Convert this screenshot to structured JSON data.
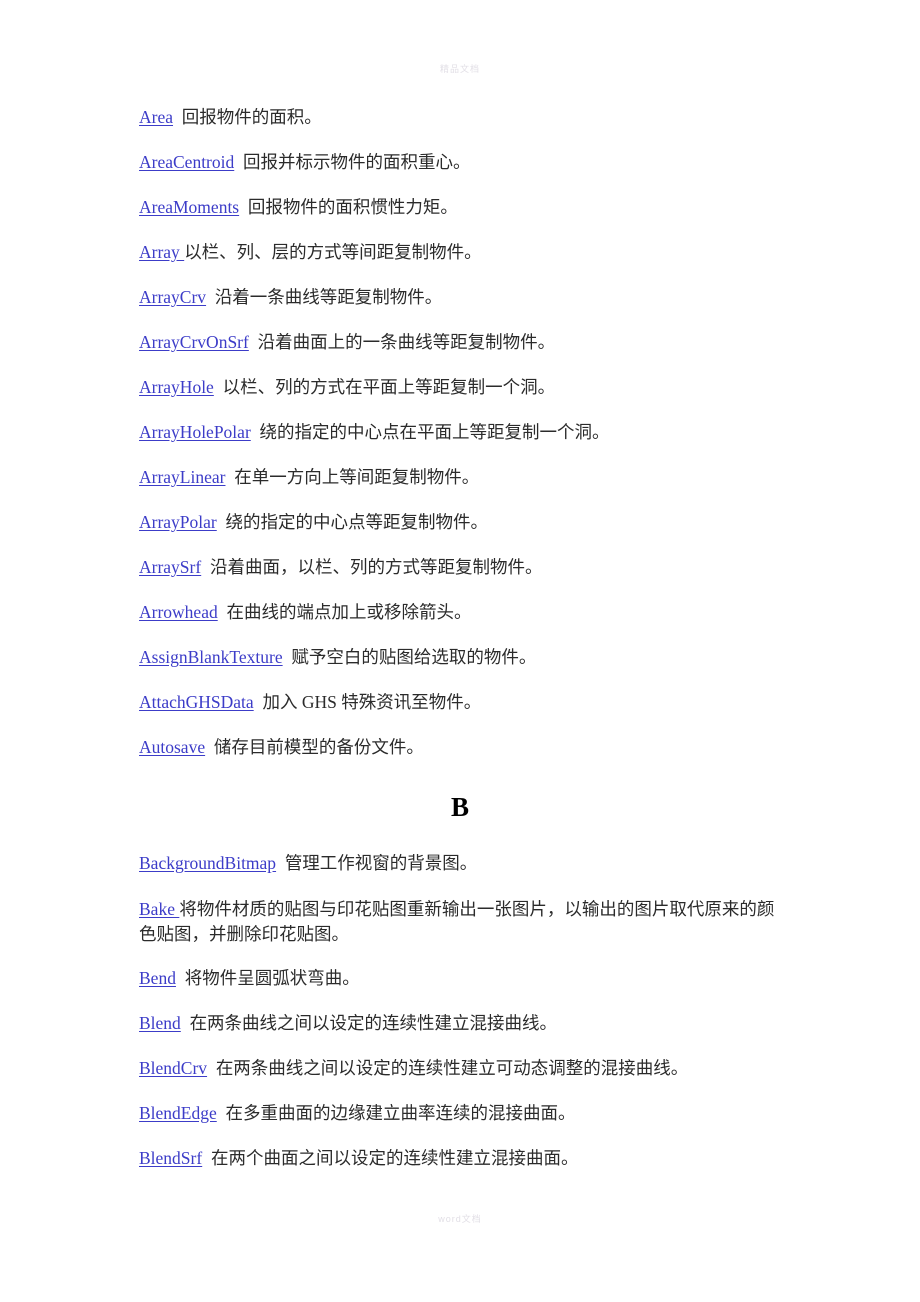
{
  "watermarks": {
    "top": "精品文档",
    "bottom": "word文档"
  },
  "sections": [
    {
      "heading": null,
      "entries": [
        {
          "command": "Area",
          "separator": "  ",
          "description": "回报物件的面积。"
        },
        {
          "command": "AreaCentroid",
          "separator": "  ",
          "description": "回报并标示物件的面积重心。"
        },
        {
          "command": "AreaMoments",
          "separator": "  ",
          "description": "回报物件的面积惯性力矩。"
        },
        {
          "command": "Array ",
          "separator": "",
          "description": "以栏、列、层的方式等间距复制物件。"
        },
        {
          "command": "ArrayCrv",
          "separator": "  ",
          "description": "沿着一条曲线等距复制物件。"
        },
        {
          "command": "ArrayCrvOnSrf",
          "separator": "  ",
          "description": "沿着曲面上的一条曲线等距复制物件。"
        },
        {
          "command": "ArrayHole",
          "separator": "  ",
          "description": "以栏、列的方式在平面上等距复制一个洞。"
        },
        {
          "command": "ArrayHolePolar",
          "separator": "  ",
          "description": "绕的指定的中心点在平面上等距复制一个洞。"
        },
        {
          "command": "ArrayLinear",
          "separator": "  ",
          "description": "在单一方向上等间距复制物件。"
        },
        {
          "command": "ArrayPolar",
          "separator": "  ",
          "description": "绕的指定的中心点等距复制物件。"
        },
        {
          "command": "ArraySrf",
          "separator": "  ",
          "description": "沿着曲面，以栏、列的方式等距复制物件。"
        },
        {
          "command": "Arrowhead",
          "separator": "  ",
          "description": "在曲线的端点加上或移除箭头。"
        },
        {
          "command": "AssignBlankTexture",
          "separator": "  ",
          "description": "赋予空白的贴图给选取的物件。"
        },
        {
          "command": "AttachGHSData",
          "separator": "  ",
          "description": "加入  GHS  特殊资讯至物件。"
        },
        {
          "command": "Autosave",
          "separator": "  ",
          "description": "储存目前模型的备份文件。"
        }
      ]
    },
    {
      "heading": "B",
      "entries": [
        {
          "command": "BackgroundBitmap",
          "separator": "  ",
          "description": "管理工作视窗的背景图。"
        },
        {
          "command": "Bake ",
          "separator": "",
          "description": "将物件材质的贴图与印花贴图重新输出一张图片，以输出的图片取代原来的颜色贴图，并删除印花贴图。",
          "wrap": true
        },
        {
          "command": "Bend",
          "separator": "  ",
          "description": "将物件呈圆弧状弯曲。"
        },
        {
          "command": "Blend",
          "separator": "  ",
          "description": "在两条曲线之间以设定的连续性建立混接曲线。"
        },
        {
          "command": "BlendCrv",
          "separator": "  ",
          "description": "在两条曲线之间以设定的连续性建立可动态调整的混接曲线。"
        },
        {
          "command": "BlendEdge",
          "separator": "  ",
          "description": "在多重曲面的边缘建立曲率连续的混接曲面。"
        },
        {
          "command": "BlendSrf",
          "separator": "  ",
          "description": "在两个曲面之间以设定的连续性建立混接曲面。"
        }
      ]
    }
  ],
  "colors": {
    "link": "#3c3cc8",
    "text": "#2b2b2b",
    "heading": "#000000",
    "watermark": "#e2dfe6",
    "background": "#ffffff"
  }
}
